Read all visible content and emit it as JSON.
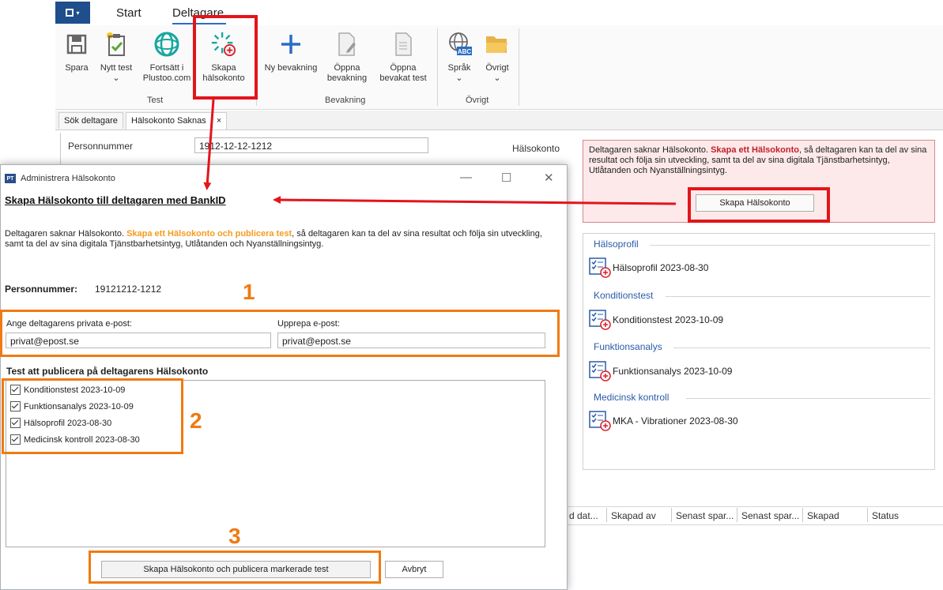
{
  "menu": {
    "tabs": [
      "Start",
      "Deltagare"
    ]
  },
  "ribbon": {
    "buttons": [
      {
        "label": "Spara"
      },
      {
        "label": "Nytt test",
        "dropdown": "⌄"
      },
      {
        "label": "Fortsätt i",
        "label2": "Plustoo.com"
      },
      {
        "label": "Skapa",
        "label2": "hälsokonto"
      },
      {
        "label": "Ny bevakning"
      },
      {
        "label": "Öppna",
        "label2": "bevakning"
      },
      {
        "label": "Öppna",
        "label2": "bevakat test"
      },
      {
        "label": "Språk",
        "dropdown": "⌄",
        "badge": "ABC"
      },
      {
        "label": "Övrigt",
        "dropdown": "⌄"
      }
    ],
    "groups": [
      "Test",
      "Bevakning",
      "Övrigt"
    ]
  },
  "doc_tabs": [
    "Sök deltagare",
    "Hälsokonto Saknas"
  ],
  "doc_tab_close": "×",
  "main": {
    "personnummer_label": "Personnummer",
    "personnummer_value": "1912-12-12-1212",
    "halsokonto_label": "Hälsokonto"
  },
  "warning": {
    "text_before": "Deltagaren saknar Hälsokonto. ",
    "text_bold": "Skapa ett Hälsokonto",
    "text_after": ", så deltagaren kan ta del av sina resultat och följa sin utveckling, samt ta del av sina digitala Tjänstbarhetsintyg, Utlåtanden och Nyanställningsintyg.",
    "button": "Skapa Hälsokonto"
  },
  "sections": [
    {
      "title": "Hälsoprofil",
      "item": "Hälsoprofil 2023-08-30"
    },
    {
      "title": "Konditionstest",
      "item": "Konditionstest 2023-10-09"
    },
    {
      "title": "Funktionsanalys",
      "item": "Funktionsanalys 2023-10-09"
    },
    {
      "title": "Medicinsk kontroll",
      "item": "MKA - Vibrationer 2023-08-30"
    }
  ],
  "grid_columns": [
    "d dat...",
    "Skapad av",
    "Senast spar...",
    "Senast spar...",
    "Skapad",
    "Status"
  ],
  "dialog": {
    "app_icon": "PT",
    "title": "Administrera Hälsokonto",
    "controls": {
      "minimize": "—",
      "maximize": "☐",
      "close": "✕"
    },
    "heading": "Skapa Hälsokonto till deltagaren med BankID",
    "desc_before": "Deltagaren saknar Hälsokonto. ",
    "desc_bold": "Skapa ett Hälsokonto och publicera test",
    "desc_after": ", så deltagaren kan ta del av sina resultat och följa sin utveckling, samt ta del av sina digitala Tjänstbarhetsintyg, Utlåtanden och Nyanställningsintyg.",
    "pnr_label": "Personnummer:",
    "pnr_value": "19121212-1212",
    "email_label": "Ange deltagarens privata e-post:",
    "email_value": "privat@epost.se",
    "repeat_label": "Upprepa e-post:",
    "repeat_value": "privat@epost.se",
    "tests_label": "Test att publicera på deltagarens Hälsokonto",
    "tests": [
      "Konditionstest 2023-10-09",
      "Funktionsanalys 2023-10-09",
      "Hälsoprofil 2023-08-30",
      "Medicinsk kontroll 2023-08-30"
    ],
    "create_button": "Skapa Hälsokonto och publicera markerade test",
    "cancel_button": "Avbryt"
  },
  "annotations": [
    "1",
    "2",
    "3"
  ],
  "colors": {
    "accent": "#2b6cc4",
    "warning_red": "#c0202a",
    "annotation_red": "#e3141b",
    "annotation_orange": "#f07a12"
  }
}
